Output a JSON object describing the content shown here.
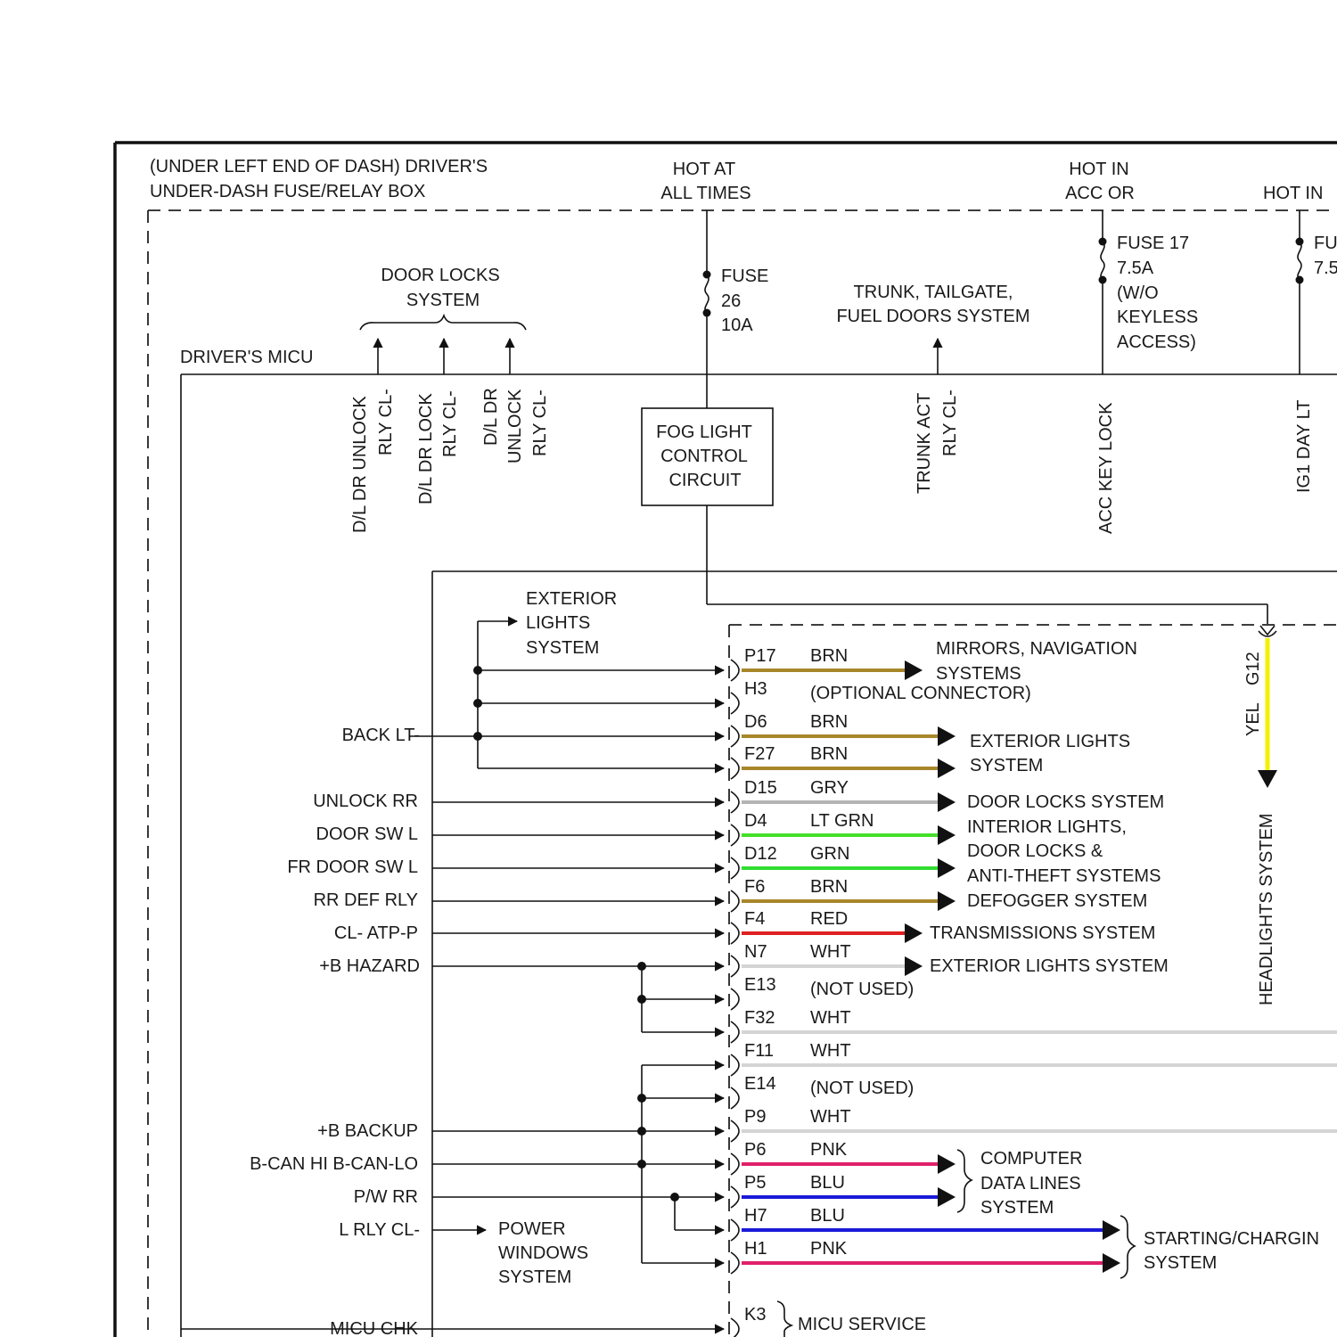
{
  "header": {
    "box_title_1": "(UNDER LEFT END OF DASH) DRIVER'S",
    "box_title_2": "UNDER-DASH FUSE/RELAY BOX",
    "hot_always_1": "HOT AT",
    "hot_always_2": "ALL TIMES",
    "hot_acc_1": "HOT IN",
    "hot_acc_2": "ACC OR",
    "hot_in_right": "HOT IN"
  },
  "fuses": {
    "fuse26": {
      "l1": "FUSE",
      "l2": "26",
      "l3": "10A"
    },
    "fuse17": {
      "l1": "FUSE 17",
      "l2": "7.5A",
      "l3": "(W/O",
      "l4": "KEYLESS",
      "l5": "ACCESS)"
    },
    "fuse_right": {
      "l1": "FU",
      "l2": "7.5"
    }
  },
  "micu": {
    "label": "DRIVER'S MICU",
    "door_locks_1": "DOOR LOCKS",
    "door_locks_2": "SYSTEM",
    "trunk_1": "TRUNK, TAILGATE,",
    "trunk_2": "FUEL DOORS SYSTEM",
    "pins_top": {
      "p1a": "D/L DR UNLOCK",
      "p1b": "RLY CL-",
      "p2a": "D/L DR LOCK",
      "p2b": "RLY CL-",
      "p3a": "D/L DR",
      "p3b": "UNLOCK",
      "p3c": "RLY CL-",
      "p4a": "TRUNK ACT",
      "p4b": "RLY CL-",
      "p5": "ACC KEY LOCK",
      "p6": "IG1 DAY LT"
    },
    "fog_1": "FOG LIGHT",
    "fog_2": "CONTROL",
    "fog_3": "CIRCUIT",
    "ext_1": "EXTERIOR",
    "ext_2": "LIGHTS",
    "ext_3": "SYSTEM",
    "pw_1": "POWER",
    "pw_2": "WINDOWS",
    "pw_3": "SYSTEM"
  },
  "left_labels": {
    "back": "BACK LT-",
    "unlock": "UNLOCK RR",
    "door_sw": "DOOR SW L",
    "fr_door": "FR DOOR SW L",
    "rr_def": "RR DEF RLY",
    "atp": "CL- ATP-P",
    "hazard": "+B HAZARD",
    "backup": "+B BACKUP",
    "bcan": "B-CAN HI B-CAN-LO",
    "pw_rr": "P/W RR",
    "lrly": "L RLY CL-",
    "micu_chk": "MICU CHK"
  },
  "pins": [
    {
      "pin": "P17",
      "color": "BRN"
    },
    {
      "pin": "H3",
      "color": "(OPTIONAL CONNECTOR)"
    },
    {
      "pin": "D6",
      "color": "BRN"
    },
    {
      "pin": "F27",
      "color": "BRN"
    },
    {
      "pin": "D15",
      "color": "GRY"
    },
    {
      "pin": "D4",
      "color": "LT GRN"
    },
    {
      "pin": "D12",
      "color": "GRN"
    },
    {
      "pin": "F6",
      "color": "BRN"
    },
    {
      "pin": "F4",
      "color": "RED"
    },
    {
      "pin": "N7",
      "color": "WHT"
    },
    {
      "pin": "E13",
      "color": "(NOT USED)"
    },
    {
      "pin": "F32",
      "color": "WHT"
    },
    {
      "pin": "F11",
      "color": "WHT"
    },
    {
      "pin": "E14",
      "color": "(NOT USED)"
    },
    {
      "pin": "P9",
      "color": "WHT"
    },
    {
      "pin": "P6",
      "color": "PNK"
    },
    {
      "pin": "P5",
      "color": "BLU"
    },
    {
      "pin": "H7",
      "color": "BLU"
    },
    {
      "pin": "H1",
      "color": "PNK"
    },
    {
      "pin": "K3",
      "color": ""
    }
  ],
  "destinations": {
    "mirrors_1": "MIRRORS, NAVIGATION",
    "mirrors_2": "SYSTEMS",
    "ext_lights_1": "EXTERIOR LIGHTS",
    "ext_lights_2": "SYSTEM",
    "door_locks": "DOOR LOCKS SYSTEM",
    "interior_1": "INTERIOR LIGHTS,",
    "interior_2": "DOOR LOCKS &",
    "interior_3": "ANTI-THEFT SYSTEMS",
    "defogger": "DEFOGGER SYSTEM",
    "transmission": "TRANSMISSIONS SYSTEM",
    "ext_lights_single": "EXTERIOR LIGHTS SYSTEM",
    "computer_1": "COMPUTER",
    "computer_2": "DATA LINES",
    "computer_3": "SYSTEM",
    "starting_1": "STARTING/CHARGIN",
    "starting_2": "SYSTEM",
    "micu_service": "MICU SERVICE"
  },
  "headlights": {
    "wire_color": "YEL",
    "pin": "G12",
    "system": "HEADLIGHTS SYSTEM"
  },
  "wire_colors": {
    "BRN": "#a8862a",
    "GRY": "#b4b4b4",
    "LT GRN": "#44e02a",
    "GRN": "#33dd33",
    "RED": "#e02020",
    "WHT": "#d4d4d4",
    "PNK": "#e0206a",
    "BLU": "#1a1ad8",
    "YEL": "#f2f200"
  }
}
